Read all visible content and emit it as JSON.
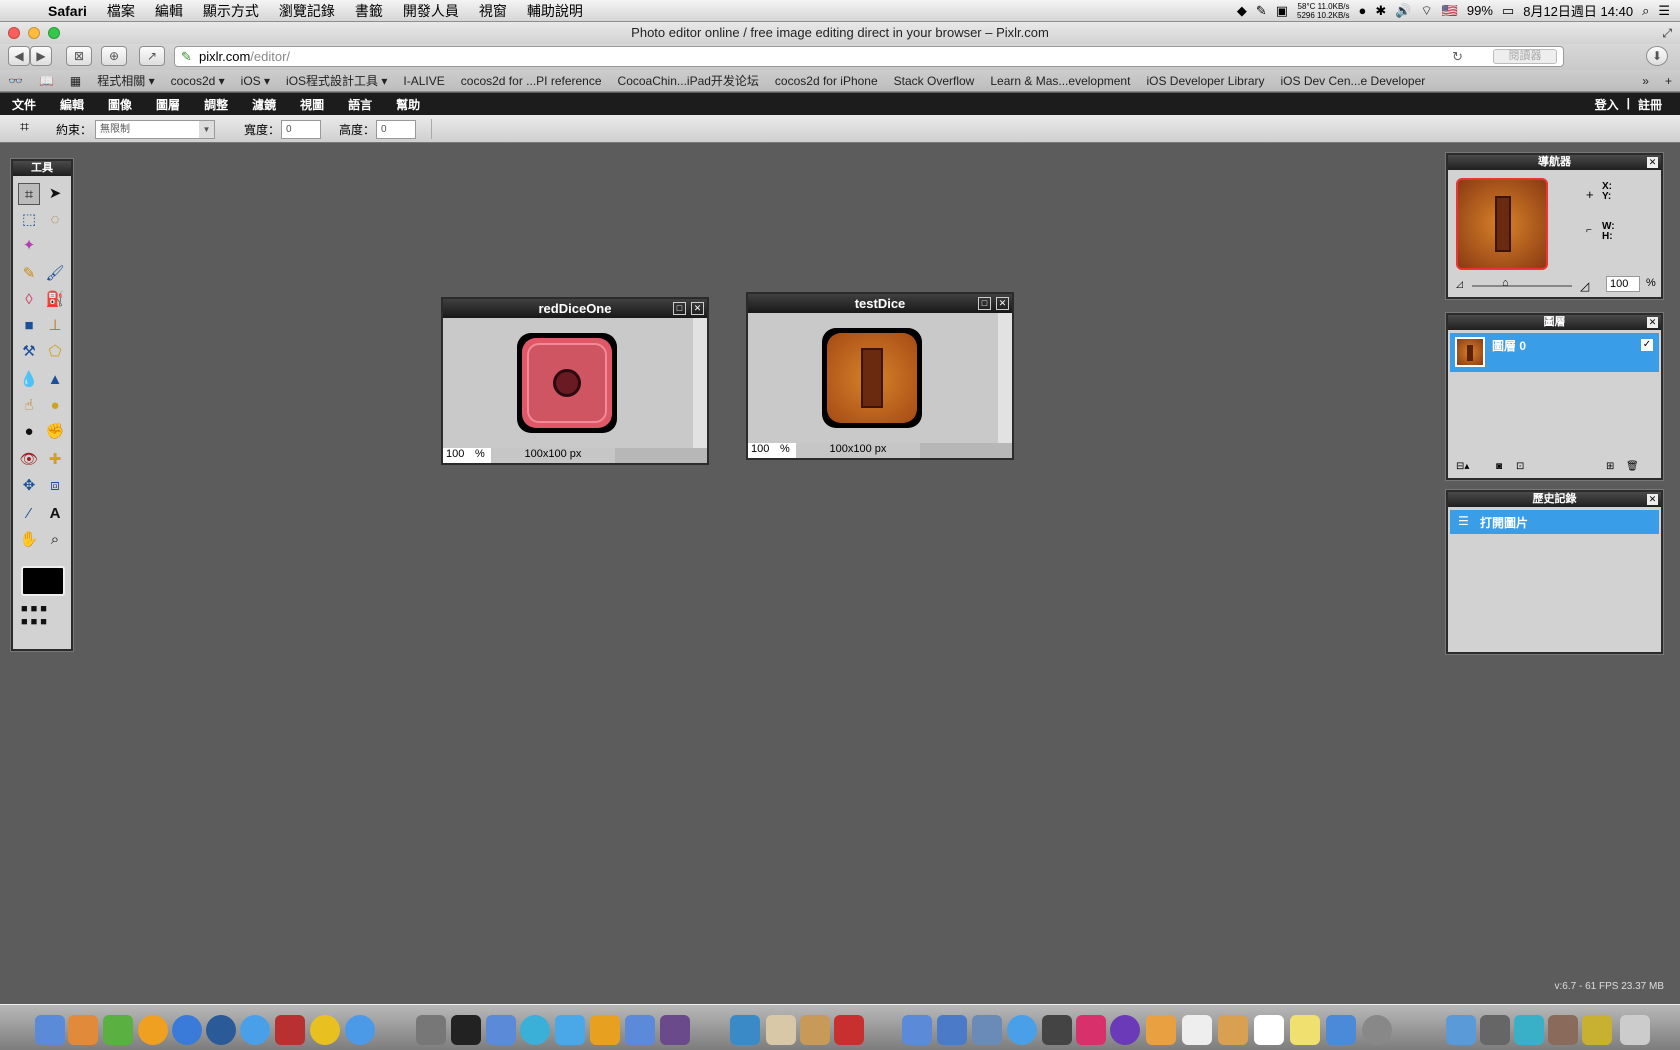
{
  "menubar": {
    "app": "Safari",
    "items": [
      "檔案",
      "編輯",
      "顯示方式",
      "瀏覽記錄",
      "書籤",
      "開發人員",
      "視窗",
      "輔助說明"
    ],
    "stats_top": "58°C  11.0KB/s",
    "stats_bottom": "5296  10.2KB/s",
    "battery": "99%",
    "flag": "🇺🇸",
    "datetime": "8月12日週日  14:40"
  },
  "window": {
    "title": "Photo editor online / free image editing direct in your browser – Pixlr.com"
  },
  "browser": {
    "url_host": "pixlr.com",
    "url_path": "/editor/",
    "reader_label": "閱讀器",
    "bookmarks": [
      "程式相關 ▾",
      "cocos2d ▾",
      "iOS ▾",
      "iOS程式設計工具 ▾",
      "I-ALIVE",
      "cocos2d for ...PI reference",
      "CocoaChin...iPad开发论坛",
      "cocos2d for iPhone",
      "Stack Overflow",
      "Learn & Mas...evelopment",
      "iOS Developer Library",
      "iOS Dev Cen...e Developer"
    ]
  },
  "pixlr": {
    "menu": [
      "文件",
      "編輯",
      "圖像",
      "圖層",
      "調整",
      "濾鏡",
      "視圖",
      "語言",
      "幫助"
    ],
    "login": "登入",
    "sep": "|",
    "register": "註冊",
    "options": {
      "constraint_label": "約束：",
      "constraint_value": "無限制",
      "width_label": "寬度：",
      "width_value": "0",
      "height_label": "高度：",
      "height_value": "0"
    },
    "tools_title": "工具",
    "docs": [
      {
        "title": "redDiceOne",
        "zoom": "100",
        "pct": "%",
        "size": "100x100 px"
      },
      {
        "title": "testDice",
        "zoom": "100",
        "pct": "%",
        "size": "100x100 px"
      }
    ],
    "navigator": {
      "title": "導航器",
      "x": "X:",
      "y": "Y:",
      "w": "W:",
      "h": "H:",
      "zoom": "100",
      "pct": "%"
    },
    "layers": {
      "title": "圖層",
      "items": [
        "圖層 0"
      ]
    },
    "history": {
      "title": "歷史記錄",
      "items": [
        "打開圖片"
      ]
    },
    "version": "v:6.7 - 61 FPS 23.37 MB"
  },
  "colors": {
    "selection": "#3a9de8",
    "dock_bg": "#9a9a9a"
  }
}
